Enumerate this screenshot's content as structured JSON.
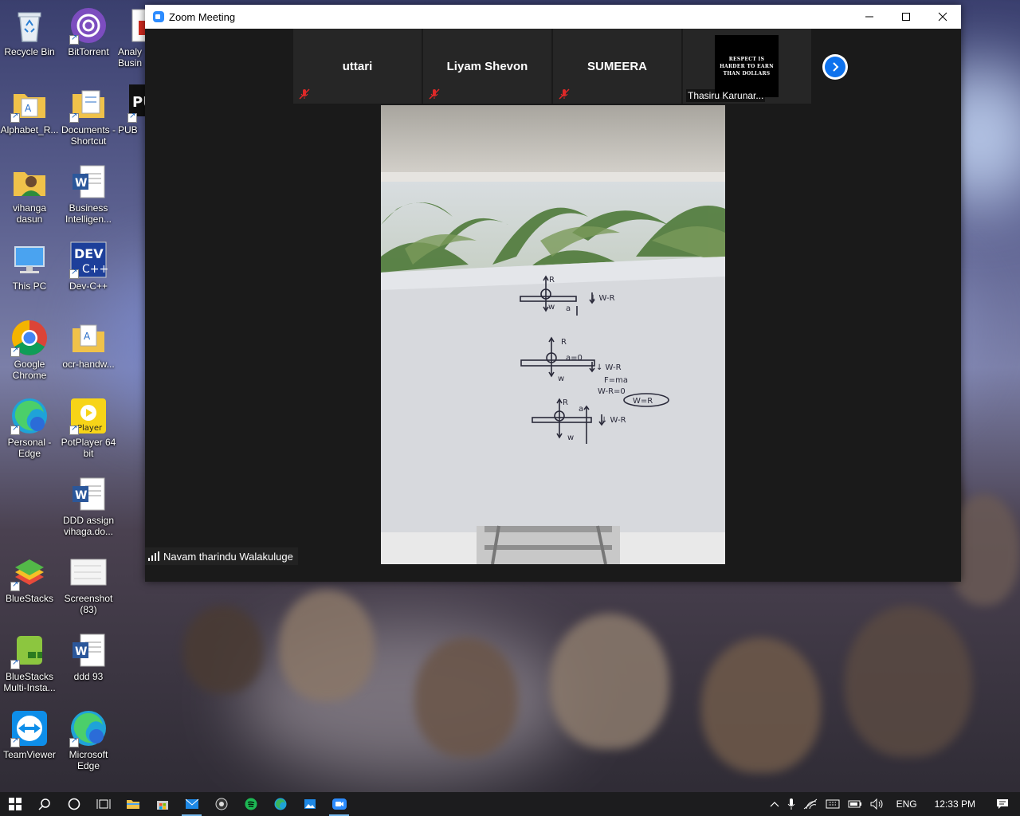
{
  "desktop": {
    "icons": [
      {
        "label": "Recycle Bin",
        "icon": "recycle-bin-icon"
      },
      {
        "label": "BitTorrent",
        "icon": "bittorrent-icon"
      },
      {
        "label": "Analy Busin",
        "icon": "pdf-icon"
      },
      {
        "label": "Alphabet_R...",
        "icon": "folder-icon"
      },
      {
        "label": "Documents - Shortcut",
        "icon": "folder-icon"
      },
      {
        "label": "PUB",
        "icon": "pubg-icon"
      },
      {
        "label": "vihanga dasun",
        "icon": "user-folder-icon"
      },
      {
        "label": "Business Intelligen...",
        "icon": "word-document-icon"
      },
      {
        "label": "This PC",
        "icon": "computer-icon"
      },
      {
        "label": "Dev-C++",
        "icon": "devcpp-icon"
      },
      {
        "label": "Google Chrome",
        "icon": "chrome-icon"
      },
      {
        "label": "ocr-handw...",
        "icon": "folder-icon"
      },
      {
        "label": "Personal - Edge",
        "icon": "edge-icon"
      },
      {
        "label": "PotPlayer 64 bit",
        "icon": "potplayer-icon"
      },
      {
        "label": "DDD assign vihaga.do...",
        "icon": "word-document-icon"
      },
      {
        "label": "BlueStacks",
        "icon": "bluestacks-icon"
      },
      {
        "label": "Screenshot (83)",
        "icon": "image-file-icon"
      },
      {
        "label": "BlueStacks Multi-Insta...",
        "icon": "bluestacks-multi-icon"
      },
      {
        "label": "ddd 93",
        "icon": "word-document-icon"
      },
      {
        "label": "TeamViewer",
        "icon": "teamviewer-icon"
      },
      {
        "label": "Microsoft Edge",
        "icon": "edge-icon"
      }
    ]
  },
  "zoom": {
    "title": "Zoom Meeting",
    "window_controls": {
      "minimize": "—",
      "maximize": "☐",
      "close": "✕"
    },
    "participants": [
      {
        "name": "uttari",
        "muted": true
      },
      {
        "name": "Liyam Shevon",
        "muted": true
      },
      {
        "name": "SUMEERA",
        "muted": true
      },
      {
        "name": "Thasiru Karunar...",
        "muted": false,
        "image_text": [
          "RESPECT IS",
          "HARDER TO EARN",
          "THAN DOLLARS"
        ]
      }
    ],
    "active_speaker": "Navam tharindu Walakuluge",
    "whiteboard": {
      "line1": [
        "R",
        "↓ W-R",
        "w",
        "a"
      ],
      "line2": [
        "R",
        "a=0",
        "↓ W-R",
        "F=ma",
        "W-R=0",
        "W=R",
        "w"
      ],
      "line3": [
        "R",
        "a",
        "↓ W-R",
        "w"
      ]
    }
  },
  "taskbar": {
    "pinned": [
      "start-icon",
      "search-icon",
      "cortana-icon",
      "task-view-icon",
      "file-explorer-icon",
      "store-icon",
      "mail-icon",
      "obs-icon",
      "spotify-icon",
      "edge-dev-icon",
      "photos-icon",
      "zoom-icon"
    ],
    "language": "ENG",
    "time": "12:33 PM"
  }
}
